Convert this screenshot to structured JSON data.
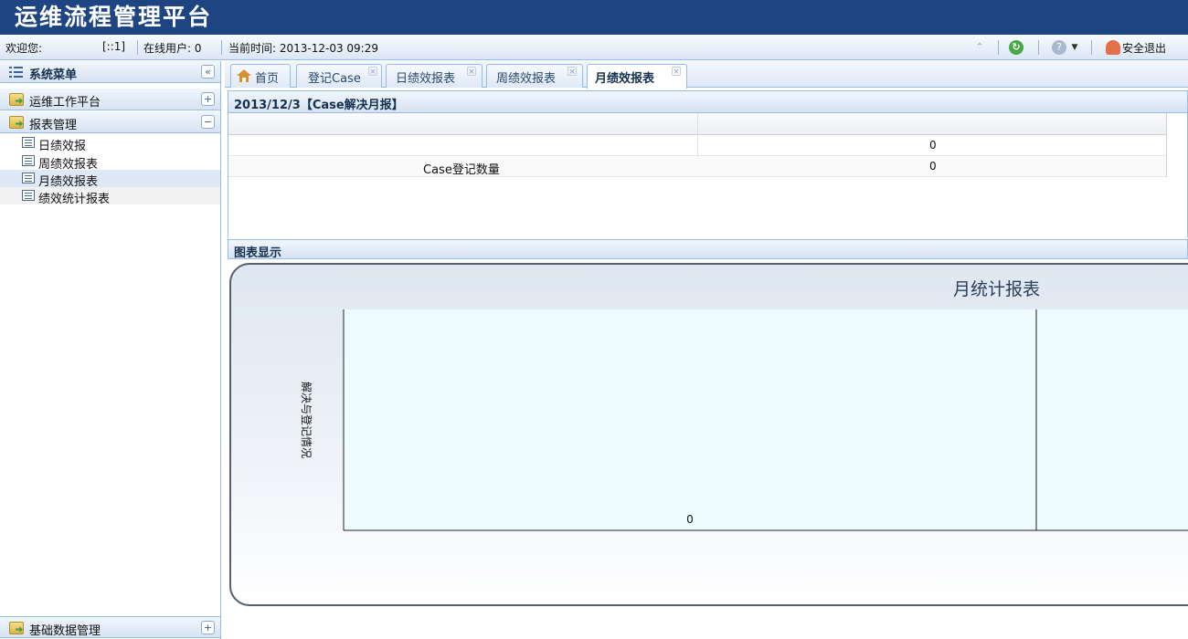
{
  "header": {
    "title": "运维流程管理平台"
  },
  "status": {
    "welcome_label": "欢迎您:",
    "user_suffix": "[::1]",
    "online_label": "在线用户: 0",
    "time_label": "当前时间: 2013-12-03 09:29",
    "logout_label": "安全退出"
  },
  "sidebar": {
    "title": "系统菜单",
    "groups": [
      {
        "label": "运维工作平台",
        "expanded": false
      },
      {
        "label": "报表管理",
        "expanded": true,
        "items": [
          {
            "label": "日绩效报"
          },
          {
            "label": "周绩效报表"
          },
          {
            "label": "月绩效报表"
          },
          {
            "label": "绩效统计报表"
          }
        ]
      },
      {
        "label": "基础数据管理",
        "expanded": false
      }
    ],
    "active_item": "月绩效报表"
  },
  "tabs": [
    {
      "label": "首页"
    },
    {
      "label": "登记Case"
    },
    {
      "label": "日绩效报表"
    },
    {
      "label": "周绩效报表"
    },
    {
      "label": "月绩效报表",
      "active": true
    }
  ],
  "report": {
    "title": "2013/12/3【Case解决月报】",
    "rows": [
      {
        "label": "",
        "value": "0"
      },
      {
        "label": "Case登记数量",
        "value": "0"
      }
    ]
  },
  "chart_section": {
    "title": "图表显示"
  },
  "chart_data": {
    "type": "bar",
    "title": "月统计报表",
    "ylabel": "解决与登记情况",
    "categories": [
      "0"
    ],
    "series": [
      {
        "values": [
          0
        ]
      }
    ]
  },
  "colors": {
    "header_bg": "#1e4582",
    "panel_border": "#99bbe8",
    "plot_bg": "#eefcff"
  }
}
